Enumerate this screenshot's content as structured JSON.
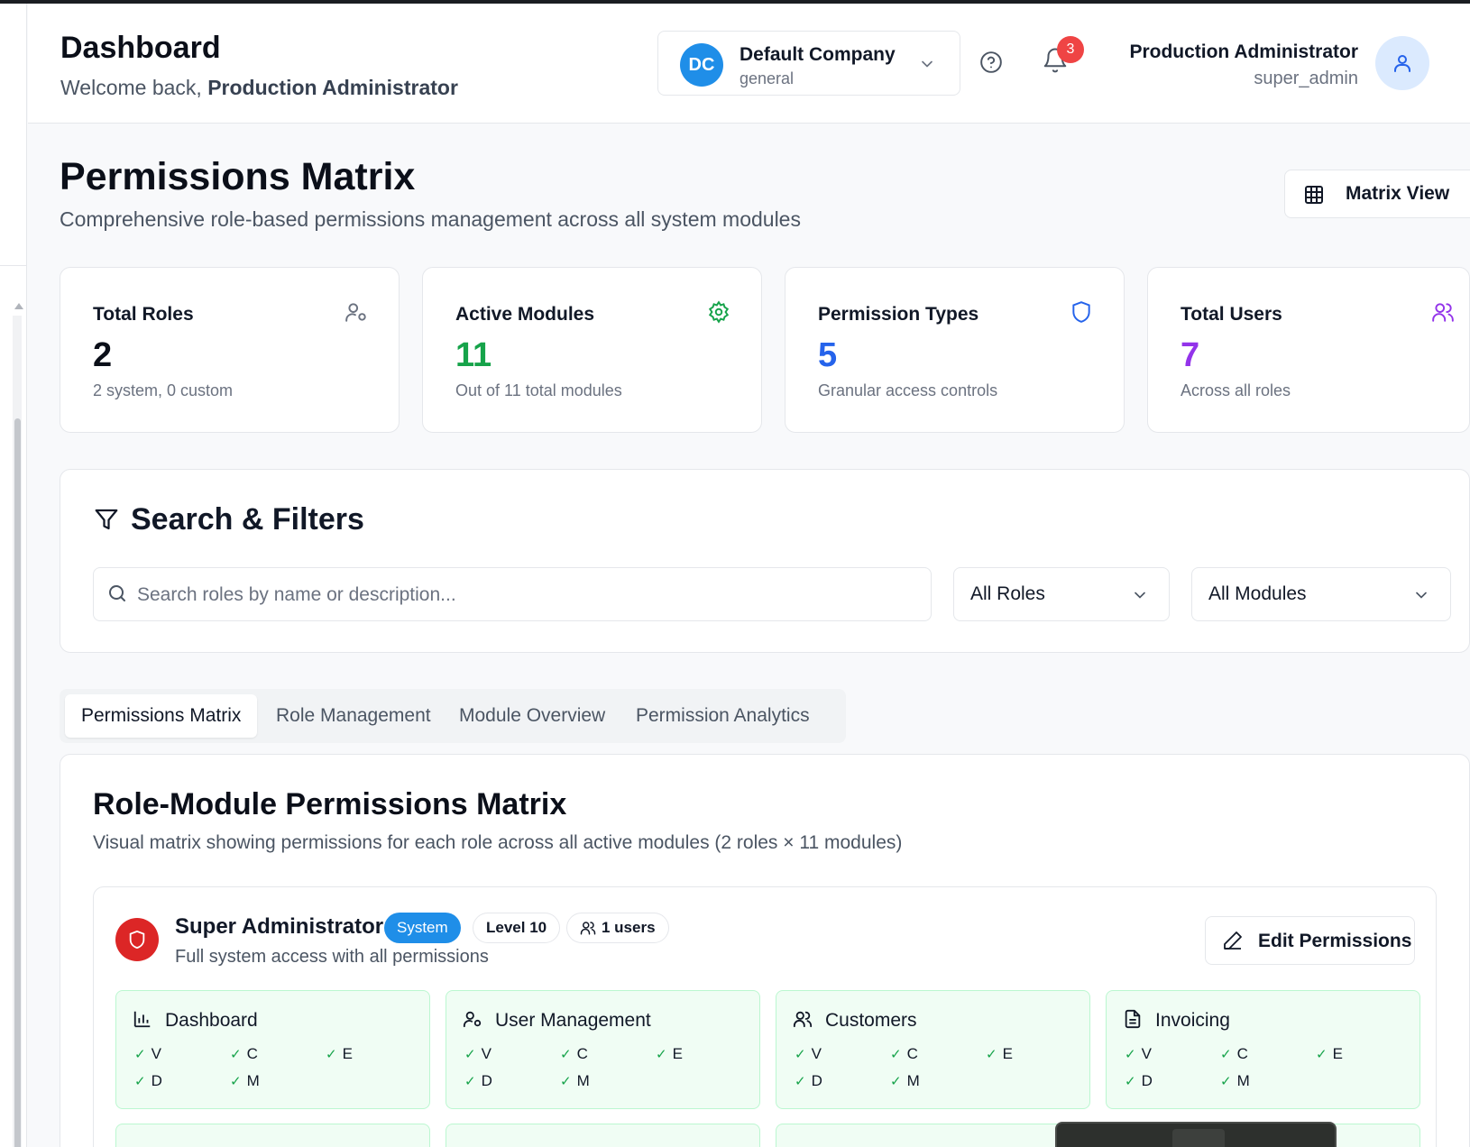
{
  "header": {
    "title": "Dashboard",
    "welcome_prefix": "Welcome back,",
    "welcome_user": "Production Administrator",
    "company": {
      "initials": "DC",
      "name": "Default Company",
      "sub": "general"
    },
    "notifications_count": "3",
    "user": {
      "name": "Production Administrator",
      "role": "super_admin"
    }
  },
  "page": {
    "title": "Permissions Matrix",
    "subtitle": "Comprehensive role-based permissions management across all system modules",
    "view_button": "Matrix View"
  },
  "stats": [
    {
      "label": "Total Roles",
      "value": "2",
      "desc": "2 system, 0 custom",
      "color": "#0b0f19",
      "icon": "user-cog-icon"
    },
    {
      "label": "Active Modules",
      "value": "11",
      "desc": "Out of 11 total modules",
      "color": "#16a34a",
      "icon": "gear-icon"
    },
    {
      "label": "Permission Types",
      "value": "5",
      "desc": "Granular access controls",
      "color": "#2563eb",
      "icon": "shield-icon"
    },
    {
      "label": "Total Users",
      "value": "7",
      "desc": "Across all roles",
      "color": "#9333ea",
      "icon": "users-icon"
    }
  ],
  "filters": {
    "title": "Search & Filters",
    "search_placeholder": "Search roles by name or description...",
    "roles_select": "All Roles",
    "modules_select": "All Modules"
  },
  "tabs": [
    "Permissions Matrix",
    "Role Management",
    "Module Overview",
    "Permission Analytics"
  ],
  "matrix": {
    "title": "Role-Module Permissions Matrix",
    "subtitle": "Visual matrix showing permissions for each role across all active modules (2 roles × 11 modules)",
    "role": {
      "name": "Super Administrator",
      "badge_system": "System",
      "badge_level": "Level 10",
      "badge_users": "1 users",
      "description": "Full system access with all permissions",
      "edit_button": "Edit Permissions"
    },
    "modules": [
      {
        "name": "Dashboard",
        "icon": "bar-chart-icon",
        "perms": [
          "V",
          "C",
          "E",
          "D",
          "M"
        ]
      },
      {
        "name": "User Management",
        "icon": "user-cog-icon",
        "perms": [
          "V",
          "C",
          "E",
          "D",
          "M"
        ]
      },
      {
        "name": "Customers",
        "icon": "users-icon",
        "perms": [
          "V",
          "C",
          "E",
          "D",
          "M"
        ]
      },
      {
        "name": "Invoicing",
        "icon": "file-text-icon",
        "perms": [
          "V",
          "C",
          "E",
          "D",
          "M"
        ]
      }
    ]
  },
  "colors": {
    "accent": "#1f8ee8",
    "success": "#16a34a",
    "danger": "#dc2626"
  }
}
